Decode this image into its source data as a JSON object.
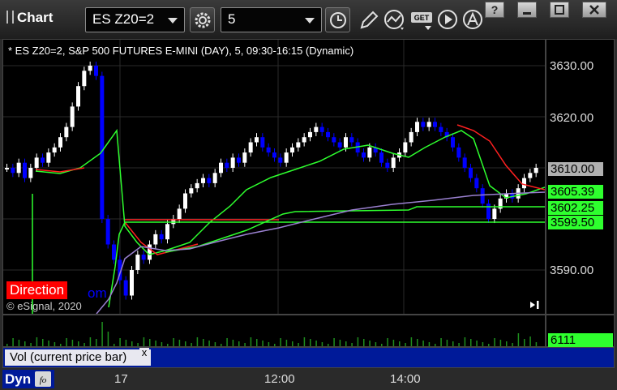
{
  "toolbar": {
    "title": "Chart",
    "symbol": "ES Z20=2",
    "interval": "5",
    "get_label": "GET"
  },
  "window_controls": [
    "?",
    "_",
    "□",
    "×"
  ],
  "chart": {
    "title": "* ES Z20=2, S&P 500 FUTURES E-MINI (DAY), 5, 09:30-16:15 (Dynamic)",
    "direction_label": "Direction",
    "copyright": "© eSignal, 2020",
    "watermark_fragment": "om"
  },
  "price_axis": {
    "ticks": [
      "3630.00",
      "3620.00",
      "3610.00",
      "3590.00"
    ],
    "tags": [
      {
        "label": "3610.00",
        "bg": "#b0b0b0",
        "fg": "#000000"
      },
      {
        "label": "3605.39",
        "bg": "#2eff2e",
        "fg": "#000000"
      },
      {
        "label": "3602.25",
        "bg": "#2eff2e",
        "fg": "#000000"
      },
      {
        "label": "3599.50",
        "bg": "#2eff2e",
        "fg": "#000000"
      }
    ]
  },
  "volume": {
    "label": "Vol (current price bar)",
    "close_label": "x",
    "value": "6111"
  },
  "time_axis": {
    "dyn_label": "Dyn",
    "ticks": [
      "17",
      "12:00",
      "14:00"
    ]
  },
  "colors": {
    "up_candle": "#ffffff",
    "down_candle": "#0000ff",
    "ma_green": "#2eff2e",
    "ma_red": "#ff2020",
    "vwap_purple": "#9a80d0",
    "volume_strip": "#001a99"
  },
  "icons": [
    "settings-gear-icon",
    "clock-icon",
    "pencil-icon",
    "line-tool-icon",
    "get-data-icon",
    "play-icon",
    "alert-icon"
  ]
}
